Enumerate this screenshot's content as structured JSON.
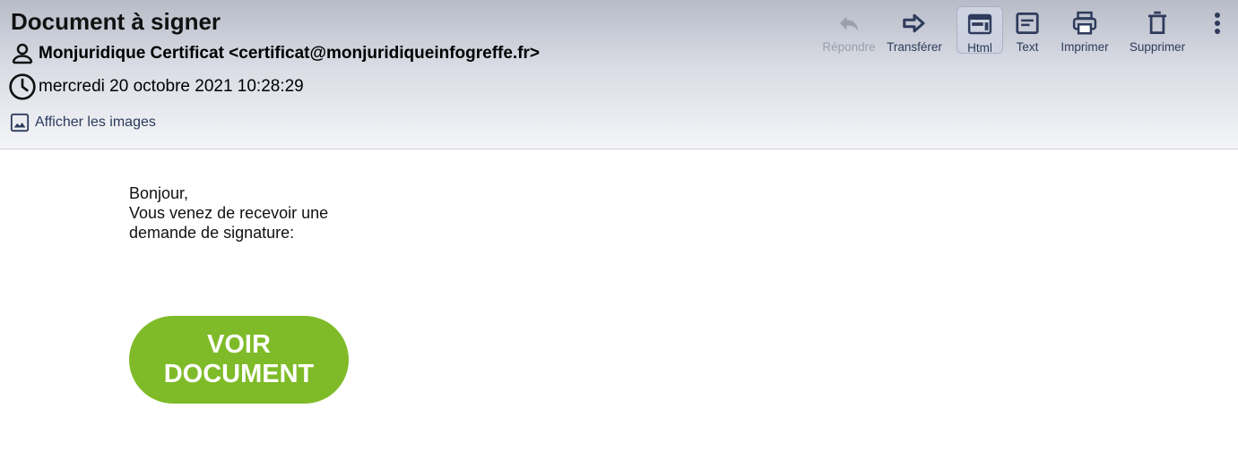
{
  "email": {
    "subject": "Document à signer",
    "from": "Monjuridique Certificat <certificat@monjuridiqueinfogreffe.fr>",
    "date": "mercredi 20 octobre 2021 10:28:29",
    "show_images": "Afficher les images"
  },
  "toolbar": {
    "reply": {
      "label": "Répondre",
      "icon": "reply-icon",
      "enabled": false
    },
    "forward": {
      "label": "Transférer",
      "icon": "forward-icon"
    },
    "html": {
      "label": "Html",
      "icon": "html-view-icon",
      "active": true
    },
    "text": {
      "label": "Text",
      "icon": "text-view-icon"
    },
    "print": {
      "label": "Imprimer",
      "icon": "print-icon"
    },
    "delete": {
      "label": "Supprimer",
      "icon": "trash-icon"
    },
    "more": {
      "icon": "more-vertical-icon"
    }
  },
  "body": {
    "lines": [
      "Bonjour,",
      "Vous venez de recevoir une",
      "demande de signature:"
    ],
    "button_label": "VOIR\nDOCUMENT"
  },
  "colors": {
    "icon": "#2e3b5c",
    "disabled": "#9aa0ac",
    "cta_background": "#7fbb28",
    "cta_text": "#ffffff"
  }
}
